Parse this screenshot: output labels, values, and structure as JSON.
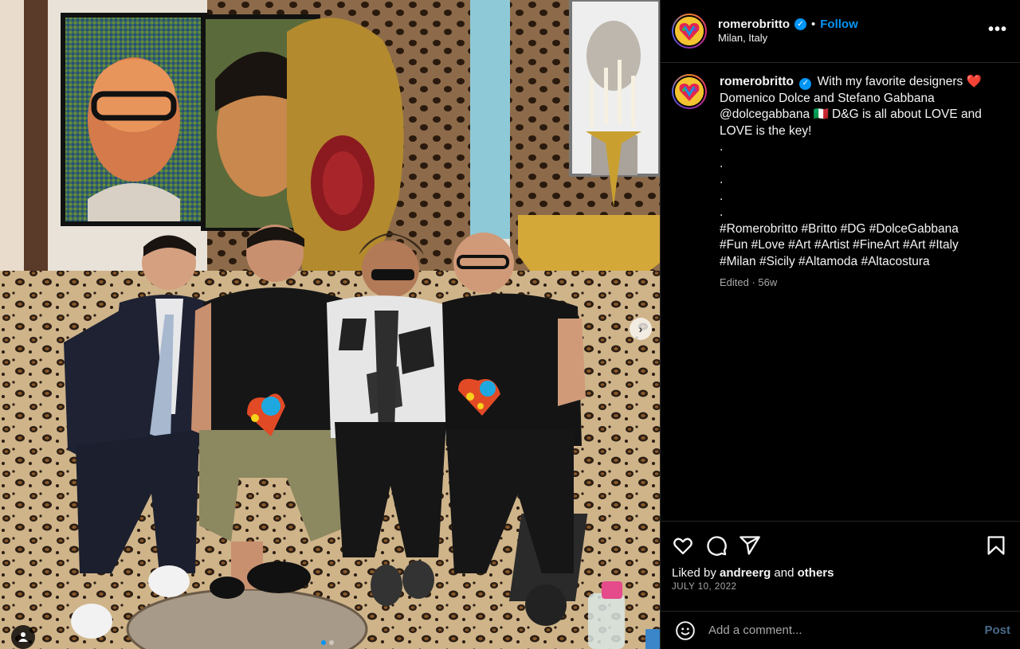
{
  "post": {
    "username": "romerobritto",
    "follow_label": "Follow",
    "separator": "•",
    "location": "Milan, Italy",
    "more_label": "•••"
  },
  "caption": {
    "username": "romerobritto",
    "lines": [
      "With my favorite designers ❤️",
      "Domenico Dolce and Stefano Gabbana",
      "@dolcegabbana 🇮🇹 D&G is all about LOVE and",
      "LOVE is the key!",
      ".",
      ".",
      ".",
      ".",
      ".",
      "#Romerobritto #Britto #DG #DolceGabbana",
      "#Fun #Love #Art #Artist #FineArt #Art #Italy",
      "#Milan #Sicily #Altamoda #Altacostura"
    ],
    "meta": "Edited · 56w"
  },
  "actions": {
    "liked_by_prefix": "Liked by",
    "liked_by_user": "andreerg",
    "liked_by_and": "and",
    "liked_by_others": "others",
    "date": "JULY 10, 2022"
  },
  "comment": {
    "placeholder": "Add a comment...",
    "post_label": "Post"
  },
  "colors": {
    "accent": "#0095f6",
    "background": "#000000",
    "muted": "#a8a8a8"
  },
  "icons": [
    "heart-icon",
    "comment-icon",
    "share-icon",
    "bookmark-icon",
    "emoji-icon",
    "verified-icon",
    "more-icon",
    "user-tag-icon",
    "chevron-right-icon"
  ],
  "carousel": {
    "slides": 2,
    "current": 1
  }
}
